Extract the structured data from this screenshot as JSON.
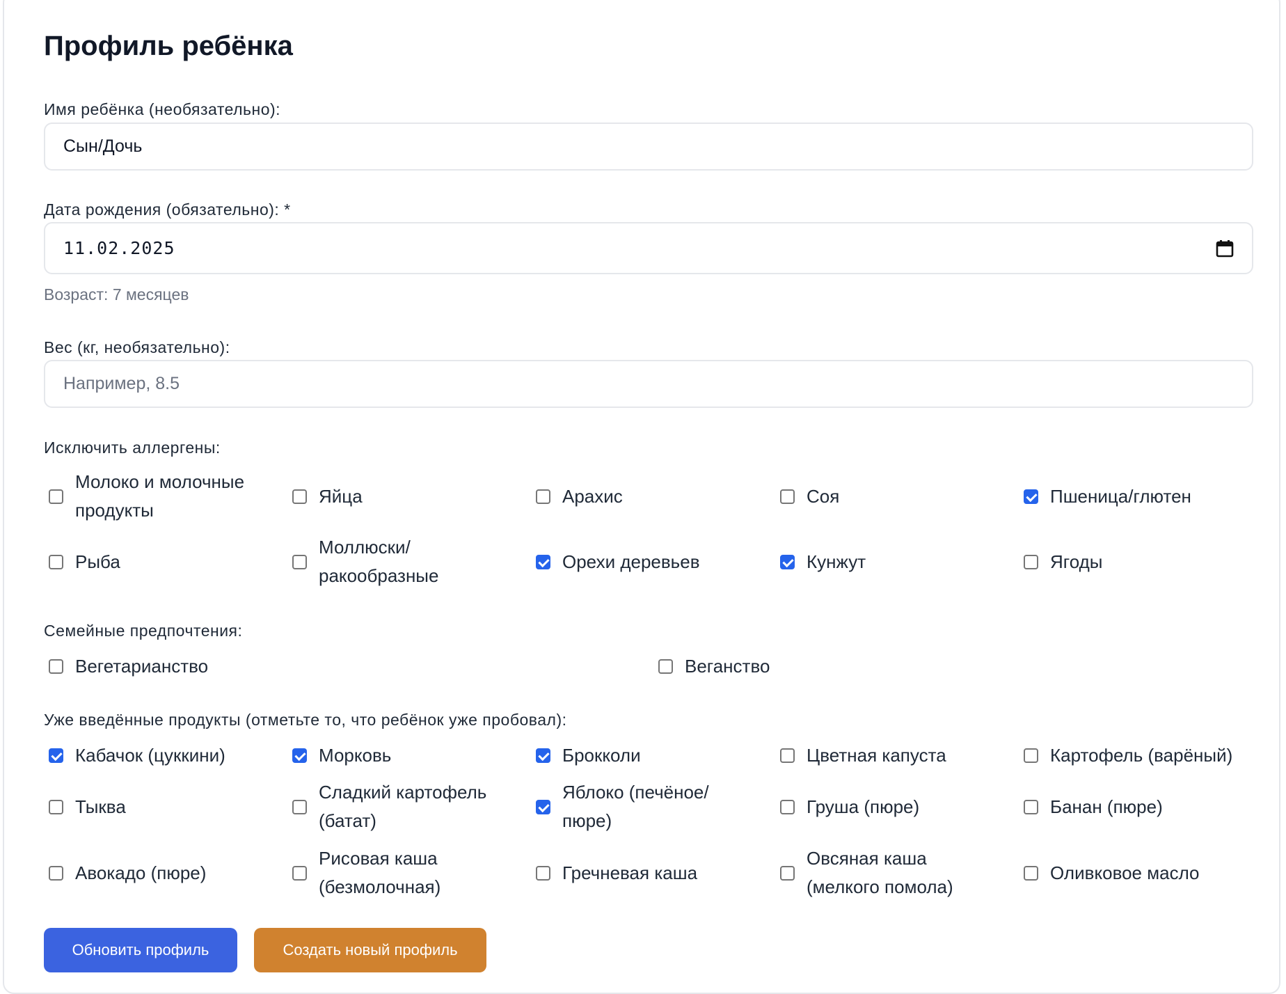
{
  "page": {
    "title": "Профиль ребёнка"
  },
  "name_field": {
    "label": "Имя ребёнка (необязательно):",
    "value": "Сын/Дочь"
  },
  "birth_field": {
    "label": "Дата рождения (обязательно): *",
    "value": "11.02.2025",
    "icon": "calendar-icon",
    "age_text": "Возраст: 7 месяцев"
  },
  "weight_field": {
    "label": "Вес (кг, необязательно):",
    "placeholder": "Например, 8.5"
  },
  "allergens": {
    "label": "Исключить аллергены:",
    "items": [
      {
        "line1": "Молоко и молочные",
        "line2": "продукты",
        "checked": false
      },
      {
        "line1": "Яйца",
        "line2": "",
        "checked": false
      },
      {
        "line1": "Арахис",
        "line2": "",
        "checked": false
      },
      {
        "line1": "Соя",
        "line2": "",
        "checked": false
      },
      {
        "line1": "Пшеница/глютен",
        "line2": "",
        "checked": true
      },
      {
        "line1": "Рыба",
        "line2": "",
        "checked": false
      },
      {
        "line1": "Моллюски/",
        "line2": "ракообразные",
        "checked": false
      },
      {
        "line1": "Орехи деревьев",
        "line2": "",
        "checked": true
      },
      {
        "line1": "Кунжут",
        "line2": "",
        "checked": true
      },
      {
        "line1": "Ягоды",
        "line2": "",
        "checked": false
      }
    ]
  },
  "preferences": {
    "label": "Семейные предпочтения:",
    "items": [
      {
        "line1": "Вегетарианство",
        "checked": false
      },
      {
        "line1": "Веганство",
        "checked": false
      }
    ]
  },
  "introduced": {
    "label": "Уже введённые продукты (отметьте то, что ребёнок уже пробовал):",
    "items": [
      {
        "line1": "Кабачок (цуккини)",
        "line2": "",
        "checked": true
      },
      {
        "line1": "Морковь",
        "line2": "",
        "checked": true
      },
      {
        "line1": "Брокколи",
        "line2": "",
        "checked": true
      },
      {
        "line1": "Цветная капуста",
        "line2": "",
        "checked": false
      },
      {
        "line1": "Картофель (варёный)",
        "line2": "",
        "checked": false
      },
      {
        "line1": "Тыква",
        "line2": "",
        "checked": false
      },
      {
        "line1": "Сладкий картофель",
        "line2": "(батат)",
        "checked": false
      },
      {
        "line1": "Яблоко (печёное/",
        "line2": "пюре)",
        "checked": true
      },
      {
        "line1": "Груша (пюре)",
        "line2": "",
        "checked": false
      },
      {
        "line1": "Банан (пюре)",
        "line2": "",
        "checked": false
      },
      {
        "line1": "Авокадо (пюре)",
        "line2": "",
        "checked": false
      },
      {
        "line1": "Рисовая каша",
        "line2": "(безмолочная)",
        "checked": false
      },
      {
        "line1": "Гречневая каша",
        "line2": "",
        "checked": false
      },
      {
        "line1": "Овсяная каша",
        "line2": "(мелкого помола)",
        "checked": false
      },
      {
        "line1": "Оливковое масло",
        "line2": "",
        "checked": false
      }
    ]
  },
  "buttons": {
    "update": "Обновить профиль",
    "create": "Создать новый профиль"
  },
  "colors": {
    "primary": "#3b63e0",
    "secondary": "#d0822f",
    "checkbox_checked": "#2563eb"
  }
}
